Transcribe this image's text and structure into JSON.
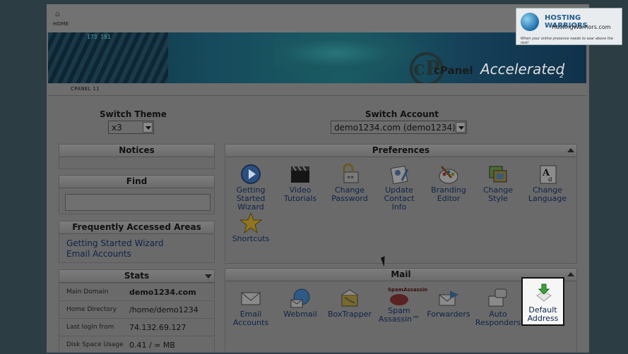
{
  "header": {
    "home_label": "HOME",
    "crumb": "CPANEL 11"
  },
  "banner": {
    "logo_letters": "cP",
    "brand": "cPanel",
    "accelerated": "Accelerated",
    "version": "2",
    "digits": "173  181"
  },
  "hosting_logo": {
    "title": "HOSTING WARRIORS",
    "site": "HostingWarriors.com",
    "tagline": "When your online presence needs to soar above the rest!"
  },
  "switch_theme": {
    "label": "Switch Theme",
    "value": "x3"
  },
  "switch_account": {
    "label": "Switch Account",
    "value": "demo1234.com (demo1234)"
  },
  "notices": {
    "title": "Notices"
  },
  "find": {
    "title": "Find",
    "placeholder": ""
  },
  "frequent": {
    "title": "Frequently Accessed Areas",
    "links": [
      "Getting Started Wizard",
      "Email Accounts"
    ]
  },
  "stats": {
    "title": "Stats",
    "rows": [
      {
        "key": "Main Domain",
        "value": "demo1234.com"
      },
      {
        "key": "Home Directory",
        "value": "/home/demo1234"
      },
      {
        "key": "Last login from",
        "value": "74.132.69.127"
      },
      {
        "key": "Disk Space Usage",
        "value": "0.41 / ∞ MB"
      }
    ]
  },
  "preferences": {
    "title": "Preferences",
    "items": [
      {
        "label": "Getting Started Wizard",
        "icon": "play-icon"
      },
      {
        "label": "Video Tutorials",
        "icon": "clapperboard-icon"
      },
      {
        "label": "Change Password",
        "icon": "lock-icon"
      },
      {
        "label": "Update Contact Info",
        "icon": "contact-card-icon"
      },
      {
        "label": "Branding Editor",
        "icon": "paint-palette-icon"
      },
      {
        "label": "Change Style",
        "icon": "style-icon"
      },
      {
        "label": "Change Language",
        "icon": "language-icon"
      },
      {
        "label": "Shortcuts",
        "icon": "star-icon"
      }
    ]
  },
  "mail": {
    "title": "Mail",
    "items": [
      {
        "label": "Email Accounts",
        "icon": "envelope-icon"
      },
      {
        "label": "Webmail",
        "icon": "webmail-globe-icon"
      },
      {
        "label": "BoxTrapper",
        "icon": "boxtrapper-icon"
      },
      {
        "label": "Spam Assassin™",
        "icon": "spamassassin-icon",
        "badge": "SpamAssassin"
      },
      {
        "label": "Forwarders",
        "icon": "forward-arrow-icon"
      },
      {
        "label": "Auto Responders",
        "icon": "autoresponder-icon"
      },
      {
        "label": "Default Address",
        "icon": "download-arrow-icon"
      }
    ]
  },
  "colors": {
    "link": "#0e2448",
    "overlay": "#6b6b6b",
    "background": "#2c3d44",
    "highlight": "#f6f6f6"
  }
}
